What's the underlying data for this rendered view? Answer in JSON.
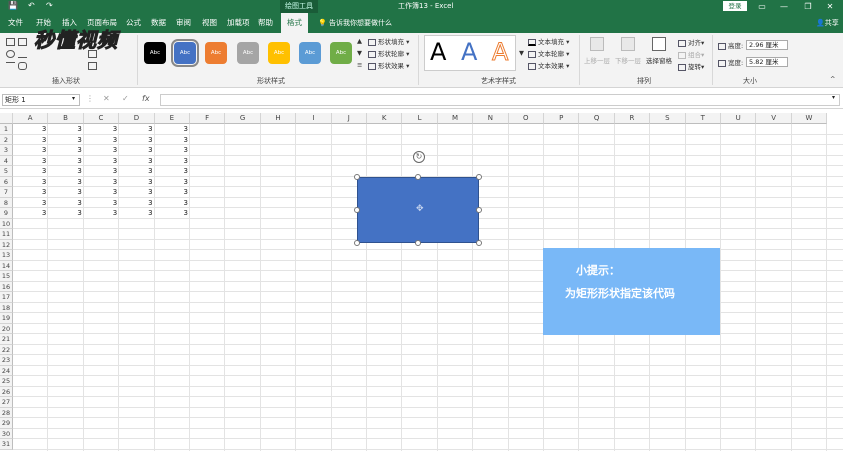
{
  "title_bar": {
    "context_tool_label": "绘图工具",
    "window_title": "工作簿13 - Excel",
    "login_label": "登录",
    "qa_save": "💾",
    "qa_undo": "↶",
    "qa_redo": "↷"
  },
  "tabs": [
    "文件",
    "开始",
    "插入",
    "页面布局",
    "公式",
    "数据",
    "审阅",
    "视图",
    "加载项",
    "帮助",
    "格式"
  ],
  "active_tab": "格式",
  "tell_me": "告诉我你想要做什么",
  "share_label": "共享",
  "ribbon": {
    "insert_shapes_label": "插入形状",
    "shape_styles_label": "形状样式",
    "wordart_styles_label": "艺术字样式",
    "arrange_label": "排列",
    "size_label": "大小",
    "swatch_text": "Abc",
    "swatch_colors": [
      "#000000",
      "#4472c4",
      "#ed7d31",
      "#a5a5a5",
      "#ffc000",
      "#5b9bd5",
      "#70ad47"
    ],
    "shape_fill": "形状填充",
    "shape_outline": "形状轮廓",
    "shape_effects": "形状效果",
    "text_fill": "文本填充",
    "text_outline": "文本轮廓",
    "text_effects": "文本效果",
    "wordart_letters": [
      "A",
      "A",
      "A"
    ],
    "bring_forward": "上移一层",
    "send_backward": "下移一层",
    "selection_pane": "选择窗格",
    "align": "对齐",
    "group": "组合",
    "rotate": "旋转",
    "height_label": "高度:",
    "height_value": "2.96 厘米",
    "width_label": "宽度:",
    "width_value": "5.82 厘米"
  },
  "logo_text": "秒懂视频",
  "formula_bar": {
    "name_box": "矩形 1",
    "cancel": "✕",
    "confirm": "✓",
    "fx": "fx",
    "formula": ""
  },
  "columns": [
    "A",
    "B",
    "C",
    "D",
    "E",
    "F",
    "G",
    "H",
    "I",
    "J",
    "K",
    "L",
    "M",
    "N",
    "O",
    "P",
    "Q",
    "R",
    "S",
    "T",
    "U",
    "V",
    "W"
  ],
  "rows": [
    "1",
    "2",
    "3",
    "4",
    "5",
    "6",
    "7",
    "8",
    "9",
    "10",
    "11",
    "12",
    "13",
    "14",
    "15",
    "16",
    "17",
    "18",
    "19",
    "20",
    "21",
    "22",
    "23",
    "24",
    "25",
    "26",
    "27",
    "28",
    "29",
    "30",
    "31"
  ],
  "cells": [
    [
      "3",
      "3",
      "3",
      "3",
      "3"
    ],
    [
      "3",
      "3",
      "3",
      "3",
      "3"
    ],
    [
      "3",
      "3",
      "3",
      "3",
      "3"
    ],
    [
      "3",
      "3",
      "3",
      "3",
      "3"
    ],
    [
      "3",
      "3",
      "3",
      "3",
      "3"
    ],
    [
      "3",
      "3",
      "3",
      "3",
      "3"
    ],
    [
      "3",
      "3",
      "3",
      "3",
      "3"
    ],
    [
      "3",
      "3",
      "3",
      "3",
      "3"
    ],
    [
      "3",
      "3",
      "3",
      "3",
      "3"
    ]
  ],
  "tip": {
    "title": "小提示：",
    "body": "为矩形形状指定该代码"
  }
}
